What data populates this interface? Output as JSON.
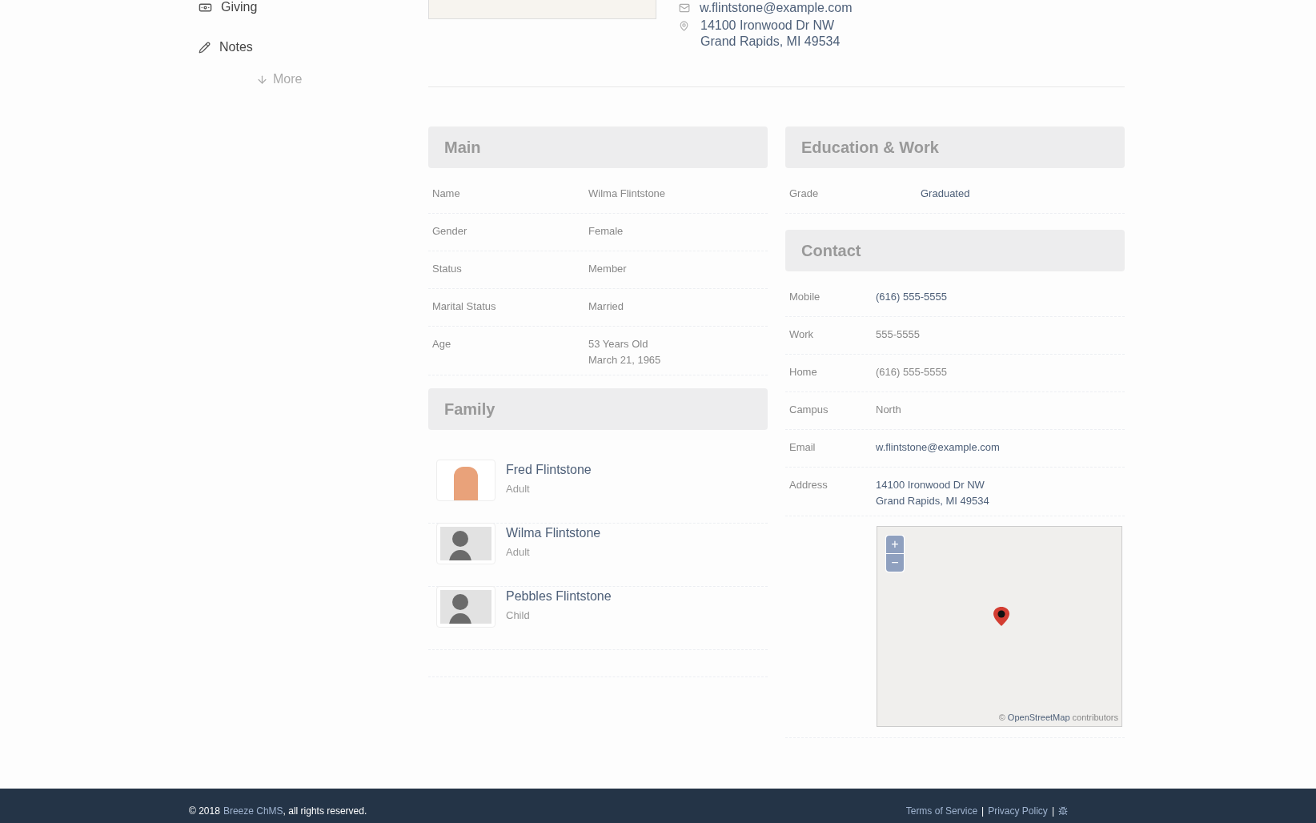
{
  "sidebar": {
    "items": [
      {
        "label": "Giving",
        "kind": "money"
      },
      {
        "label": "Notes",
        "kind": "pencil"
      }
    ],
    "more": "More"
  },
  "profile": {
    "email": "w.flintstone@example.com",
    "address": [
      "14100 Ironwood Dr NW",
      "Grand Rapids, MI 49534"
    ]
  },
  "main": {
    "title": "Main",
    "rows": [
      {
        "label": "Name",
        "value": [
          "Wilma Flintstone"
        ]
      },
      {
        "label": "Gender",
        "value": [
          "Female"
        ]
      },
      {
        "label": "Status",
        "value": [
          "Member"
        ]
      },
      {
        "label": "Marital Status",
        "value": [
          "Married"
        ]
      },
      {
        "label": "Age",
        "value": [
          "53 Years Old",
          "March 21, 1965"
        ]
      }
    ]
  },
  "family": {
    "title": "Family",
    "members": [
      {
        "name": "Fred Flintstone",
        "role": "Adult",
        "kind": "cartoon"
      },
      {
        "name": "Wilma Flintstone",
        "role": "Adult",
        "kind": "silhouette"
      },
      {
        "name": "Pebbles Flintstone",
        "role": "Child",
        "kind": "silhouette"
      }
    ]
  },
  "education": {
    "title": "Education & Work",
    "rows": [
      {
        "label": "Grade",
        "value": [
          "Graduated"
        ],
        "kind": "link"
      }
    ]
  },
  "contact": {
    "title": "Contact",
    "rows": [
      {
        "label": "Mobile",
        "value": [
          "(616) 555-5555"
        ],
        "kind": "link"
      },
      {
        "label": "Work",
        "value": [
          "555-5555"
        ],
        "kind": "text"
      },
      {
        "label": "Home",
        "value": [
          "(616) 555-5555"
        ],
        "kind": "text"
      },
      {
        "label": "Campus",
        "value": [
          "North"
        ],
        "kind": "text"
      },
      {
        "label": "Email",
        "value": [
          "w.flintstone@example.com"
        ],
        "kind": "link"
      },
      {
        "label": "Address",
        "value": [
          "14100 Ironwood Dr NW",
          "Grand Rapids, MI 49534"
        ],
        "kind": "link"
      }
    ]
  },
  "map": {
    "zoom_in": "+",
    "zoom_out": "−",
    "attribution_prefix": "©",
    "attribution_link": "OpenStreetMap",
    "attribution": "contributors"
  },
  "footer": {
    "copyright_prefix": "© 2018",
    "brand": "Breeze ChMS",
    "copyright_suffix": ", all rights reserved.",
    "links": [
      "Terms of Service",
      "Privacy Policy"
    ],
    "separators": [
      "|",
      "|"
    ]
  }
}
